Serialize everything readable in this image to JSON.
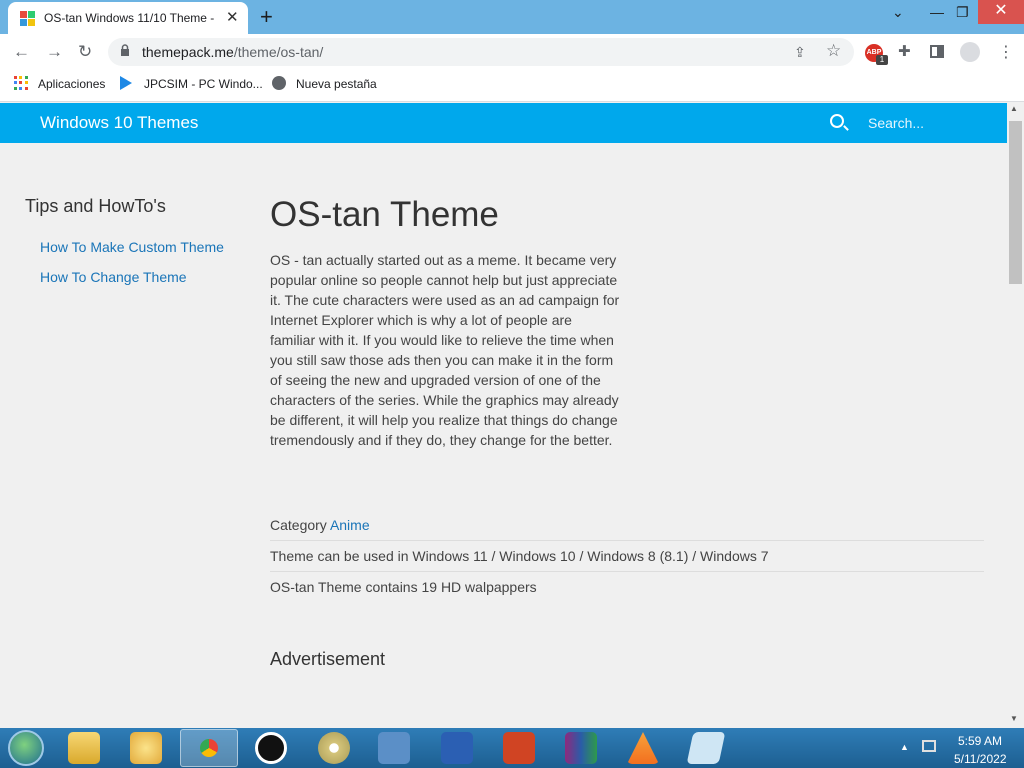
{
  "browser": {
    "tab_title": "OS-tan Windows 11/10 Theme -",
    "url_host": "themepack.me",
    "url_path": "/theme/os-tan/",
    "ext_abp_label": "ABP",
    "ext_badge_count": "1",
    "bookmarks": [
      {
        "label": "Aplicaciones"
      },
      {
        "label": "JPCSIM - PC Windo..."
      },
      {
        "label": "Nueva pestaña"
      }
    ]
  },
  "site": {
    "brand": "Windows 10 Themes",
    "search_placeholder": "Search..."
  },
  "sidebar": {
    "title": "Tips and HowTo's",
    "links": [
      {
        "label": "How To Make Custom Theme"
      },
      {
        "label": "How To Change Theme"
      }
    ]
  },
  "main": {
    "title": "OS-tan Theme",
    "description": "OS - tan actually started out as a meme. It became very popular online so people cannot help but just appreciate it. The cute characters were used as an ad campaign for Internet Explorer which is why a lot of people are familiar with it. If you would like to relieve the time when you still saw those ads then you can make it in the form of seeing the new and upgraded version of one of the characters of the series. While the graphics may already be different, it will help you realize that things do change tremendously and if they do, they change for the better.",
    "category_label": "Category",
    "category_value": "Anime",
    "compat_text": "Theme can be used in Windows 11 / Windows 10 / Windows 8 (8.1) / Windows 7",
    "wallpapers_text": "OS-tan Theme contains 19 HD walpappers",
    "ad_title": "Advertisement"
  },
  "taskbar": {
    "time": "5:59 AM",
    "date": "5/11/2022",
    "pinned_icons": [
      "explorer-icon",
      "paint-icon",
      "chrome-icon",
      "record-icon",
      "disc-icon",
      "network-monitor-icon",
      "word-icon",
      "powerpoint-icon",
      "winrar-icon",
      "vlc-icon",
      "notepad-icon"
    ]
  },
  "colors": {
    "site_header": "#00a8ec",
    "link": "#1a75b8",
    "tabstrip": "#6cb3e2",
    "taskbar": "#1d5f91"
  }
}
